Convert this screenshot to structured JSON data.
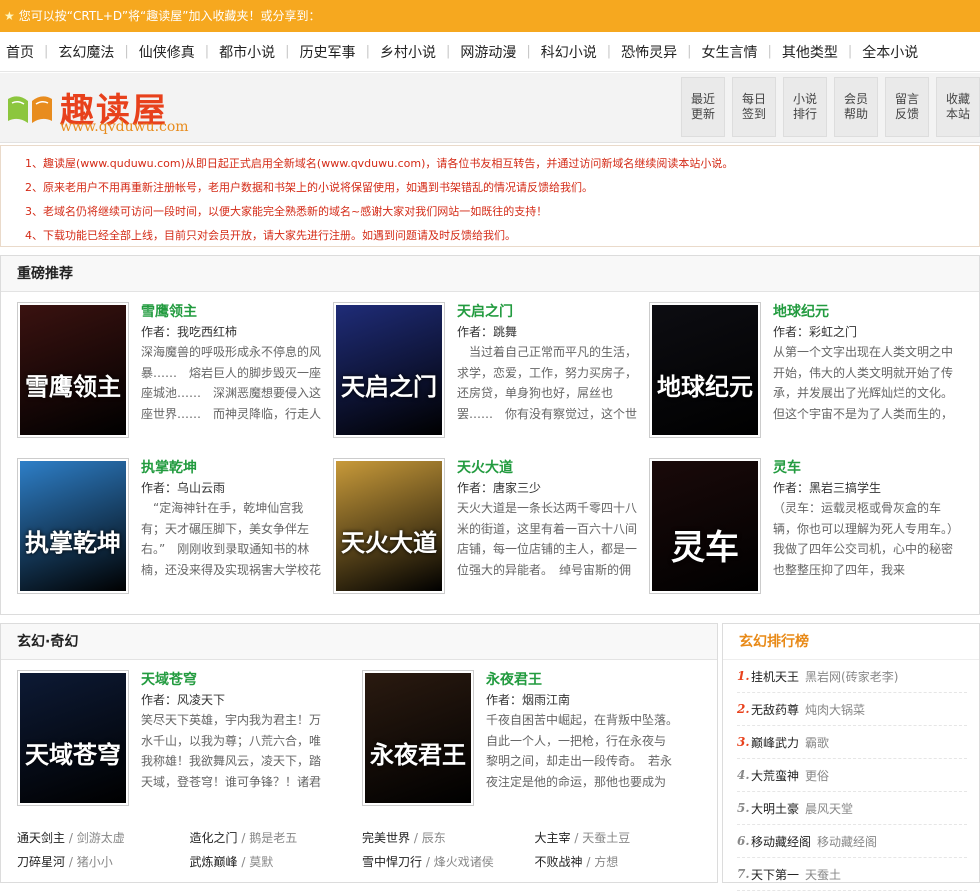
{
  "topbar": {
    "text": "您可以按“CRTL+D”将“趣读屋”加入收藏夹！或分享到："
  },
  "nav": [
    "首页",
    "玄幻魔法",
    "仙侠修真",
    "都市小说",
    "历史军事",
    "乡村小说",
    "网游动漫",
    "科幻小说",
    "恐怖灵异",
    "女生言情",
    "其他类型",
    "全本小说"
  ],
  "logo": {
    "name": "趣读屋",
    "url": "www.qvduwu.com"
  },
  "quick": [
    "最近更新",
    "每日签到",
    "小说排行",
    "会员帮助",
    "留言反馈",
    "收藏本站"
  ],
  "notices": [
    "1、趣读屋(www.quduwu.com)从即日起正式启用全新域名(www.qvduwu.com)，请各位书友相互转告，并通过访问新域名继续阅读本站小说。",
    "2、原来老用户不用再重新注册帐号，老用户数据和书架上的小说将保留使用，如遇到书架错乱的情况请反馈给我们。",
    "3、老域名仍将继续可访问一段时间，以便大家能完全熟悉新的域名~感谢大家对我们网站一如既往的支持！",
    "4、下载功能已经全部上线，目前只对会员开放，请大家先进行注册。如遇到问题请及时反馈给我们。"
  ],
  "featured": {
    "heading": "重磅推荐",
    "books": [
      {
        "title": "雪鹰领主",
        "author": "作者：我吃西红柿",
        "desc": "深海魔兽的呼吸形成永不停息的风暴……　熔岩巨人的脚步毁灭一座座城池……　深渊恶魔想要侵入这座世界……　而神灵降临，行走人",
        "cover_text": "雪鹰领主",
        "cover_bg": "#3a1210"
      },
      {
        "title": "天启之门",
        "author": "作者：跳舞",
        "desc": "　当过着自己正常而平凡的生活，求学，恋爱，工作，努力买房子，还房贷，单身狗也好，屌丝也罢……　你有没有察觉过，这个世",
        "cover_text": "天启之门",
        "cover_bg": "#1f2c78"
      },
      {
        "title": "地球纪元",
        "author": "作者：彩虹之门",
        "desc": "从第一个文字出现在人类文明之中开始，伟大的人类文明就开始了传承，并发展出了光辉灿烂的文化。　但这个宇宙不是为了人类而生的，",
        "cover_text": "地球纪元",
        "cover_bg": "#0d0d12"
      },
      {
        "title": "执掌乾坤",
        "author": "作者：乌山云雨",
        "desc": "　“定海神针在手，乾坤仙宫我有；天才碾压脚下，美女争伴左右。”　刚刚收到录取通知书的林楠，还没来得及实现祸害大学校花",
        "cover_text": "执掌乾坤",
        "cover_bg": "#2e7fc8"
      },
      {
        "title": "天火大道",
        "author": "作者：唐家三少",
        "desc": "天火大道是一条长达两千零四十八米的街道，这里有着一百六十八间店铺，每一位店铺的主人，都是一位强大的异能者。　绰号宙斯的佣",
        "cover_text": "天火大道",
        "cover_bg": "#c89a3a"
      },
      {
        "title": "灵车",
        "author": "作者：黑岩三搞学生",
        "desc": "（灵车：运载灵柩或骨灰盒的车辆，你也可以理解为死人专用车。）　我做了四年公交司机，心中的秘密也整整压抑了四年，我来",
        "cover_text": "灵车",
        "cover_bg": "#1a0a0a"
      }
    ]
  },
  "xuanhuan": {
    "heading": "玄幻·奇幻",
    "books": [
      {
        "title": "天域苍穹",
        "author": "作者：风凌天下",
        "desc": "笑尽天下英雄，宇内我为君主！万水千山，以我为尊；八荒六合，唯我称雄！我欲舞风云，凌天下，踏天域，登苍穹！谁可争锋？！诸君可愿陪我，并肩",
        "cover_text": "天域苍穹",
        "cover_bg": "#0d1a35"
      },
      {
        "title": "永夜君王",
        "author": "作者：烟雨江南",
        "desc": "千夜自困苦中崛起，在背叛中坠落。　自此一个人，一把枪，行在永夜与黎明之间，却走出一段传奇。　若永夜注定是他的命运，那他也要成为主宰的王。",
        "cover_text": "永夜君王",
        "cover_bg": "#2a1a10"
      }
    ],
    "list": [
      [
        {
          "book": "通天剑主",
          "author": "剑游太虚"
        },
        {
          "book": "造化之门",
          "author": "鹅是老五"
        },
        {
          "book": "完美世界",
          "author": "辰东"
        },
        {
          "book": "大主宰",
          "author": "天蚕土豆"
        }
      ],
      [
        {
          "book": "刀碎星河",
          "author": "猪小小"
        },
        {
          "book": "武炼巅峰",
          "author": "莫默"
        },
        {
          "book": "雪中悍刀行",
          "author": "烽火戏诸侯"
        },
        {
          "book": "不败战神",
          "author": "方想"
        }
      ]
    ]
  },
  "ranking": {
    "heading": "玄幻排行榜",
    "items": [
      {
        "n": "1.",
        "book": "挂机天王",
        "author": "黑岩网(砖家老李)",
        "color": "#e8411c"
      },
      {
        "n": "2.",
        "book": "无敌药尊",
        "author": "炖肉大锅菜",
        "color": "#e8411c"
      },
      {
        "n": "3.",
        "book": "巅峰武力",
        "author": "霸歌",
        "color": "#e8411c"
      },
      {
        "n": "4.",
        "book": "大荒蛮神",
        "author": "更俗",
        "color": "#888888"
      },
      {
        "n": "5.",
        "book": "大明土豪",
        "author": "晨风天堂",
        "color": "#888888"
      },
      {
        "n": "6.",
        "book": "移动藏经阁",
        "author": "移动藏经阁",
        "color": "#888888"
      },
      {
        "n": "7.",
        "book": "天下第一",
        "author": "天蚕土",
        "color": "#888888"
      }
    ]
  }
}
